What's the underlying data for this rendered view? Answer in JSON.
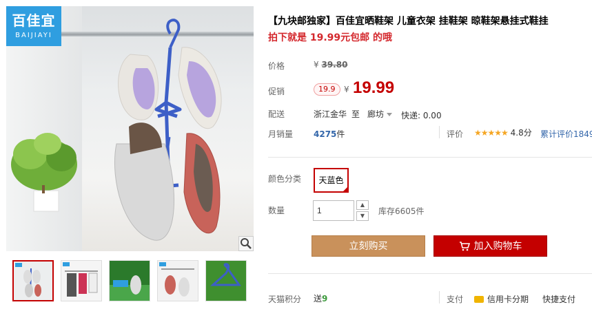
{
  "gallery": {
    "brand_cn": "百佳宜",
    "brand_en": "BAIJIAYI",
    "zoom_icon": "magnifier-icon",
    "thumbnail_count": 5
  },
  "product": {
    "title": "【九块邮独家】百佳宜晒鞋架 儿童衣架 挂鞋架 晾鞋架悬挂式鞋挂",
    "subtitle": "拍下就是 19.99元包邮 的哦"
  },
  "price": {
    "label": "价格",
    "currency": "¥",
    "original": "39.80"
  },
  "promo": {
    "label": "促销",
    "badge": "19.9",
    "currency": "¥",
    "value": "19.99"
  },
  "shipping": {
    "label": "配送",
    "from": "浙江金华",
    "to_word": "至",
    "destination": "廊坊",
    "express": "快递: 0.00"
  },
  "sales": {
    "label": "月销量",
    "count": "4275",
    "unit": "件",
    "rating_label": "评价",
    "stars": "★★★★★",
    "score": "4.8分",
    "total_reviews": "累计评价1849"
  },
  "options": {
    "color_label": "颜色分类",
    "color_value": "天蓝色",
    "qty_label": "数量",
    "qty_value": "1",
    "stock": "库存6605件"
  },
  "actions": {
    "buy_now": "立刻购买",
    "add_to_cart": "加入购物车"
  },
  "footer": {
    "points_label": "天猫积分",
    "points_prefix": "送",
    "points_value": "9",
    "payment_label": "支付",
    "credit_card": "信用卡分期",
    "quick_pay": "快捷支付"
  },
  "colors": {
    "accent_red": "#c40000",
    "buy_button": "#c9915b",
    "brand_blue": "#2f9ee0",
    "link_blue": "#3366aa"
  }
}
